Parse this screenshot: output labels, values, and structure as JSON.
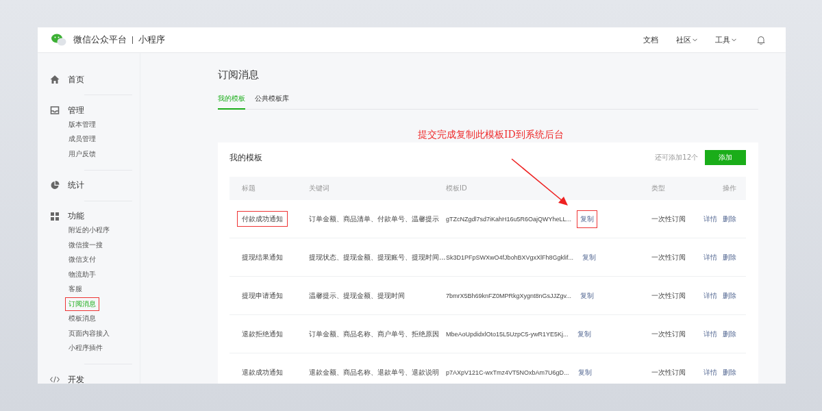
{
  "header": {
    "brand": "微信公众平台",
    "product": "小程序",
    "nav": [
      {
        "label": "文档",
        "dropdown": false
      },
      {
        "label": "社区",
        "dropdown": true
      },
      {
        "label": "工具",
        "dropdown": true
      }
    ]
  },
  "sidebar": {
    "sections": [
      {
        "label": "首页"
      },
      {
        "label": "管理",
        "children": [
          {
            "label": "版本管理",
            "selected": false,
            "highlighted": false
          },
          {
            "label": "成员管理",
            "selected": false,
            "highlighted": false
          },
          {
            "label": "用户反馈",
            "selected": false,
            "highlighted": false
          }
        ]
      },
      {
        "label": "统计"
      },
      {
        "label": "功能",
        "children": [
          {
            "label": "附近的小程序",
            "selected": false,
            "highlighted": false
          },
          {
            "label": "微信搜一搜",
            "selected": false,
            "highlighted": false
          },
          {
            "label": "微信支付",
            "selected": false,
            "highlighted": false
          },
          {
            "label": "物流助手",
            "selected": false,
            "highlighted": false
          },
          {
            "label": "客服",
            "selected": false,
            "highlighted": false
          },
          {
            "label": "订阅消息",
            "selected": true,
            "highlighted": true
          },
          {
            "label": "模板消息",
            "selected": false,
            "highlighted": false
          },
          {
            "label": "页面内容接入",
            "selected": false,
            "highlighted": false
          },
          {
            "label": "小程序插件",
            "selected": false,
            "highlighted": false
          }
        ]
      },
      {
        "label": "开发"
      }
    ]
  },
  "page_title": "订阅消息",
  "tabs": [
    {
      "label": "我的模板",
      "selected": true
    },
    {
      "label": "公共模板库",
      "selected": false
    }
  ],
  "annotation": "提交完成复制此模板ID到系统后台",
  "card": {
    "title": "我的模板",
    "remaining": "还可添加12个",
    "add_button": "添加",
    "table": {
      "columns": [
        "标题",
        "关键词",
        "模板ID",
        "类型",
        "操作"
      ],
      "rows": [
        {
          "title": "付款成功通知",
          "title_highlighted": true,
          "keywords": "订单金额、商品清单、付款单号、温馨提示",
          "template_id": "gTZcNZgdl7sd7iKahH16u5R6OajQWYheLL...",
          "copy": "复制",
          "copy_highlighted": true,
          "type": "一次性订阅",
          "detail": "详情",
          "delete": "删除"
        },
        {
          "title": "提现结果通知",
          "title_highlighted": false,
          "keywords": "提现状态、提现金额、提现账号、提现时间...",
          "template_id": "Sk3D1PFpSWXwO4fJbohBXVgxXlFh8Ggklif...",
          "copy": "复制",
          "copy_highlighted": false,
          "type": "一次性订阅",
          "detail": "详情",
          "delete": "删除"
        },
        {
          "title": "提现申请通知",
          "title_highlighted": false,
          "keywords": "温馨提示、提现金额、提现时间",
          "template_id": "7bmrX5Bh69knFZ0MPRkgXygnt8nGsJJZgv...",
          "copy": "复制",
          "copy_highlighted": false,
          "type": "一次性订阅",
          "detail": "详情",
          "delete": "删除"
        },
        {
          "title": "退款拒绝通知",
          "title_highlighted": false,
          "keywords": "订单金额、商品名称、商户单号、拒绝原因",
          "template_id": "MbeAoUpdidxlOto15L5UzpC5-ywR1YE5Kj...",
          "copy": "复制",
          "copy_highlighted": false,
          "type": "一次性订阅",
          "detail": "详情",
          "delete": "删除"
        },
        {
          "title": "退款成功通知",
          "title_highlighted": false,
          "keywords": "退款金额、商品名称、退款单号、退款说明",
          "template_id": "p7AXpV121C-wxTmz4VT5NOxbAm7U6gD...",
          "copy": "复制",
          "copy_highlighted": false,
          "type": "一次性订阅",
          "detail": "详情",
          "delete": "删除"
        }
      ]
    }
  }
}
